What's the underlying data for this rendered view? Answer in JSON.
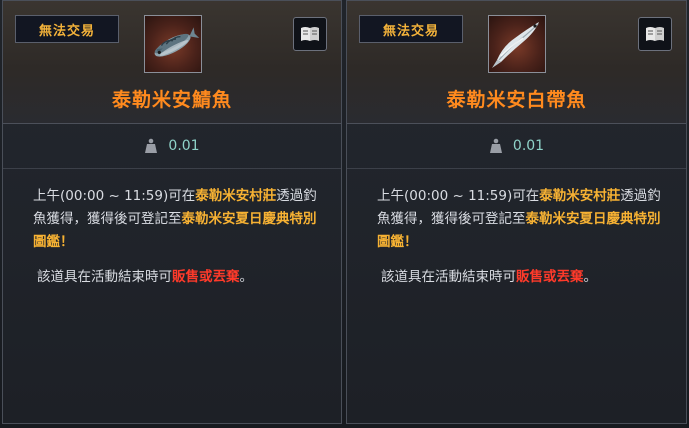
{
  "cards": [
    {
      "tag": "無法交易",
      "fish_icon": "mackerel-fish-icon",
      "title": "泰勒米安鯖魚",
      "weight": "0.01",
      "desc": {
        "p1": "上午(00:00 ~ 11:59)可在",
        "place": "泰勒米安村莊",
        "p2": "透過釣魚獲得，獲得後可登記至",
        "festival": "泰勒米安夏日慶典特別圖鑑",
        "p3": "！"
      },
      "notice": {
        "p1": "該道具在活動結束時可",
        "action": "販售或丟棄",
        "p2": "。"
      }
    },
    {
      "tag": "無法交易",
      "fish_icon": "hairtail-fish-icon",
      "title": "泰勒米安白帶魚",
      "weight": "0.01",
      "desc": {
        "p1": "上午(00:00 ~ 11:59)可在",
        "place": "泰勒米安村莊",
        "p2": "透過釣魚獲得，獲得後可登記至",
        "festival": "泰勒米安夏日慶典特別圖鑑",
        "p3": "！"
      },
      "notice": {
        "p1": "該道具在活動結束時可",
        "action": "販售或丟棄",
        "p2": "。"
      }
    }
  ],
  "colors": {
    "title_orange": "#ff8a1e",
    "highlight_gold": "#f7b233",
    "warning_red": "#ff3a2a",
    "weight_teal": "#8fd3c9"
  }
}
